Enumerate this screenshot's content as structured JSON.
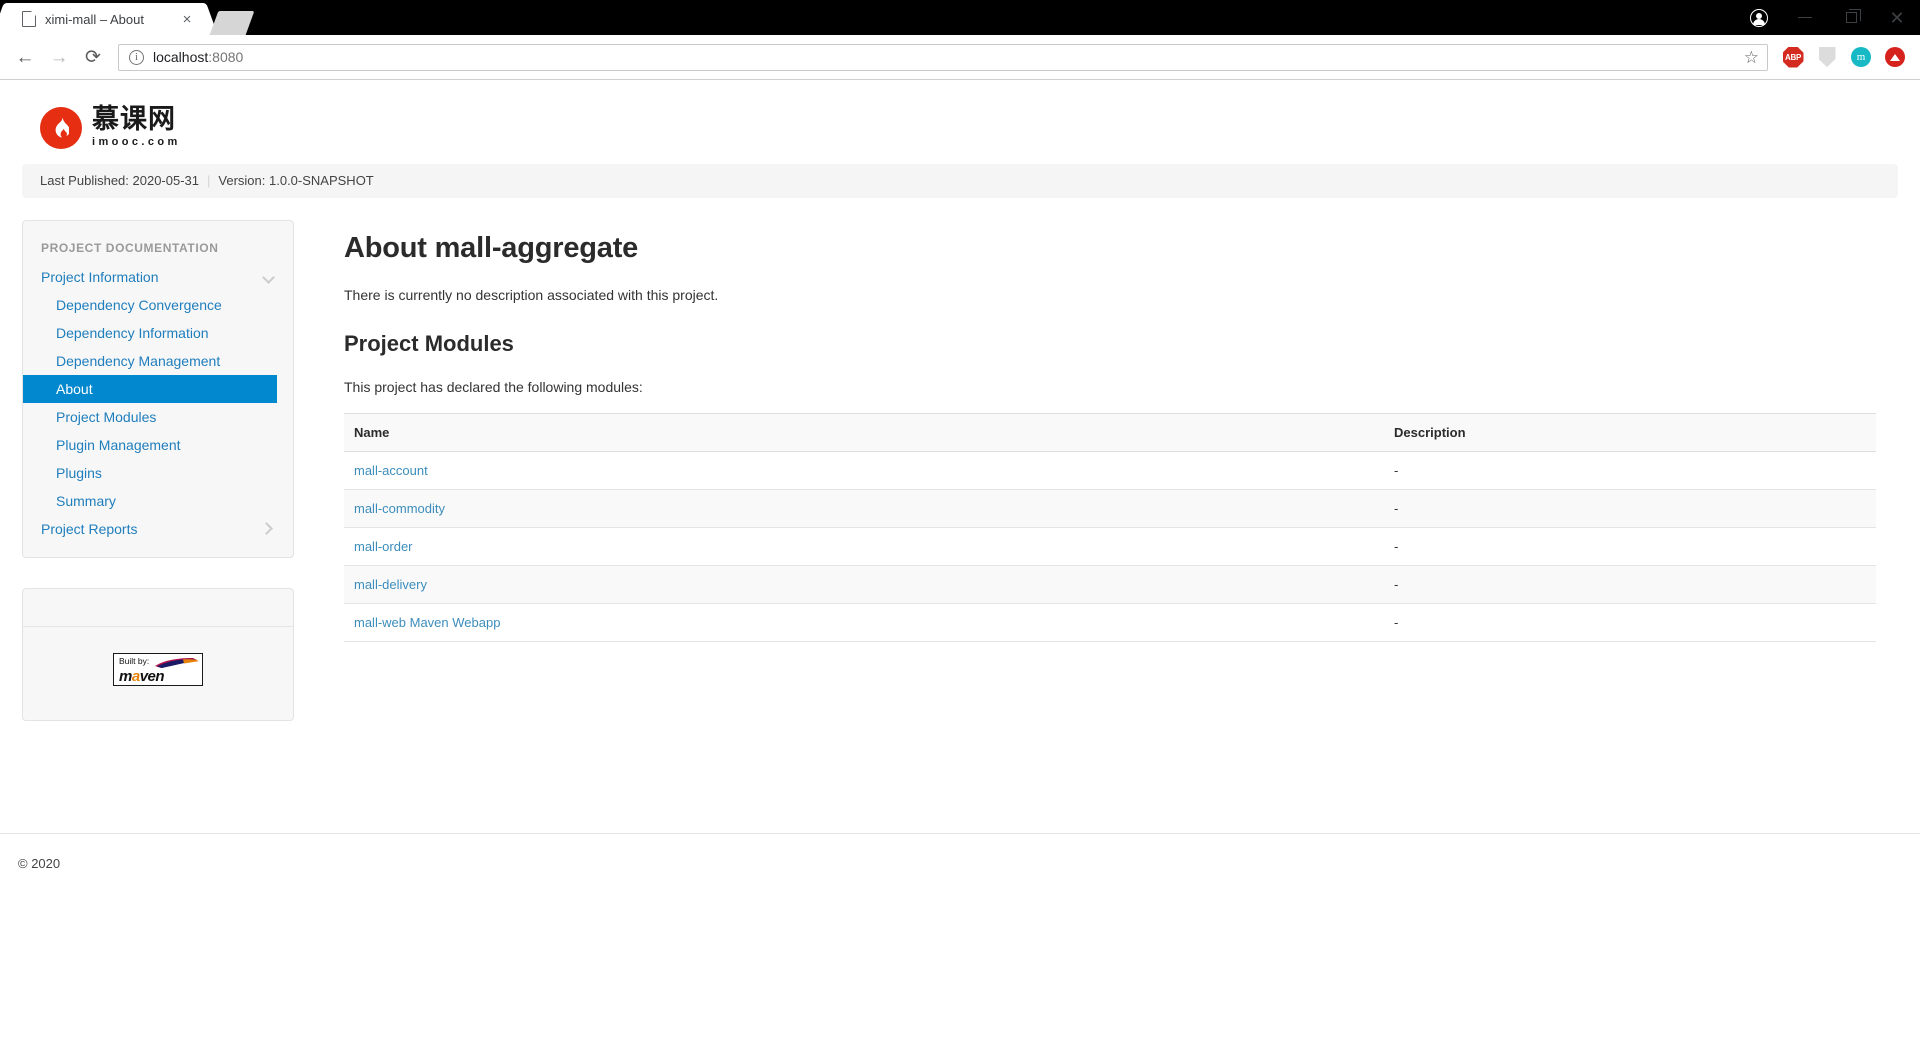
{
  "browser": {
    "tab": {
      "title": "ximi-mall – About",
      "favicon_icon": "page-icon",
      "close_icon": "×"
    },
    "new_tab_icon": "new-tab-icon",
    "nav": {
      "back_icon": "←",
      "forward_icon": "→",
      "reload_icon": "⟳"
    },
    "omnibox": {
      "info_icon": "info-circle-icon",
      "url_host": "localhost",
      "url_port": ":8080",
      "bookmark_icon": "☆"
    },
    "extensions": [
      {
        "name": "adblock-plus",
        "label": "ABP",
        "color": "#d32b20"
      },
      {
        "name": "ghostery-shield",
        "label": "",
        "color": "#dcdcdc"
      },
      {
        "name": "momentum",
        "label": "m",
        "color": "#16b9c4"
      },
      {
        "name": "upload-arrow",
        "label": "",
        "color": "#d5221d"
      }
    ],
    "window_controls": {
      "profile_icon": "profile-icon",
      "minimize_icon": "−",
      "maximize_icon": "❐",
      "close_icon": "✕"
    }
  },
  "banner": {
    "logo_cn": "慕课网",
    "logo_en": "imooc.com",
    "logo_color": "#e52e12"
  },
  "published_bar": {
    "last_published": "Last Published: 2020-05-31",
    "separator": "|",
    "version": "Version: 1.0.0-SNAPSHOT"
  },
  "sidebar": {
    "heading": "PROJECT DOCUMENTATION",
    "items": [
      {
        "label": "Project Information",
        "level": 0,
        "active": false,
        "chevron": "chevron-down-icon"
      },
      {
        "label": "Dependency Convergence",
        "level": 1,
        "active": false,
        "chevron": ""
      },
      {
        "label": "Dependency Information",
        "level": 1,
        "active": false,
        "chevron": ""
      },
      {
        "label": "Dependency Management",
        "level": 1,
        "active": false,
        "chevron": ""
      },
      {
        "label": "About",
        "level": 1,
        "active": true,
        "chevron": ""
      },
      {
        "label": "Project Modules",
        "level": 1,
        "active": false,
        "chevron": ""
      },
      {
        "label": "Plugin Management",
        "level": 1,
        "active": false,
        "chevron": ""
      },
      {
        "label": "Plugins",
        "level": 1,
        "active": false,
        "chevron": ""
      },
      {
        "label": "Summary",
        "level": 1,
        "active": false,
        "chevron": ""
      },
      {
        "label": "Project Reports",
        "level": 0,
        "active": false,
        "chevron": "chevron-right-icon"
      }
    ],
    "maven_badge": {
      "built_by": "Built by:",
      "name_m": "m",
      "name_a": "a",
      "name_ven": "ven"
    },
    "active_color": "#0288ce",
    "link_color": "#1f7ebd"
  },
  "content": {
    "title": "About mall-aggregate",
    "description": "There is currently no description associated with this project.",
    "modules_heading": "Project Modules",
    "modules_lead": "This project has declared the following modules:",
    "table": {
      "columns": [
        "Name",
        "Description"
      ],
      "rows": [
        {
          "name": "mall-account",
          "description": "-"
        },
        {
          "name": "mall-commodity",
          "description": "-"
        },
        {
          "name": "mall-order",
          "description": "-"
        },
        {
          "name": "mall-delivery",
          "description": "-"
        },
        {
          "name": "mall-web Maven Webapp",
          "description": "-"
        }
      ]
    }
  },
  "footer": {
    "copyright": "© 2020"
  }
}
